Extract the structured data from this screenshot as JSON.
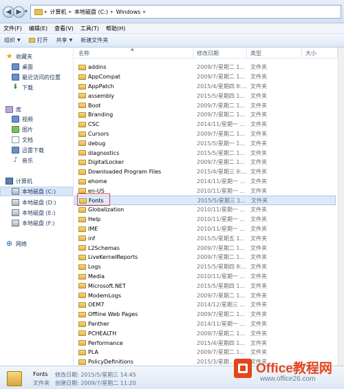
{
  "address": {
    "segments": [
      "计算机",
      "本地磁盘 (C:)",
      "Windows"
    ]
  },
  "menu": [
    "文件(F)",
    "编辑(E)",
    "查看(V)",
    "工具(T)",
    "帮助(H)"
  ],
  "toolbar": {
    "organize": "组织",
    "open": "打开",
    "share": "共享",
    "new_folder": "新建文件夹"
  },
  "sidebar": {
    "favorites": "收藏夹",
    "desktop": "桌面",
    "recent": "最近访问的位置",
    "downloads": "下载",
    "library": "库",
    "videos": "视频",
    "pictures": "图片",
    "documents": "文档",
    "thunder": "迅雷下载",
    "music": "音乐",
    "computer": "计算机",
    "drive_c": "本地磁盘 (C:)",
    "drive_d": "本地磁盘 (D:)",
    "drive_e": "本地磁盘 (E:)",
    "drive_f": "本地磁盘 (F:)",
    "network": "网络"
  },
  "columns": {
    "name": "名称",
    "date": "修改日期",
    "type": "类型",
    "size": "大小"
  },
  "files": [
    {
      "name": "addins",
      "date": "2009/7/星期二 1...",
      "type": "文件夹"
    },
    {
      "name": "AppCompat",
      "date": "2009/7/星期二 1...",
      "type": "文件夹"
    },
    {
      "name": "AppPatch",
      "date": "2015/4/星期四 8:...",
      "type": "文件夹"
    },
    {
      "name": "assembly",
      "date": "2015/5/星期四 1...",
      "type": "文件夹"
    },
    {
      "name": "Boot",
      "date": "2009/7/星期二 1...",
      "type": "文件夹"
    },
    {
      "name": "Branding",
      "date": "2009/7/星期二 1...",
      "type": "文件夹"
    },
    {
      "name": "CSC",
      "date": "2014/11/星期一 ...",
      "type": "文件夹"
    },
    {
      "name": "Cursors",
      "date": "2009/7/星期二 1...",
      "type": "文件夹"
    },
    {
      "name": "debug",
      "date": "2015/5/星期一 1...",
      "type": "文件夹"
    },
    {
      "name": "diagnostics",
      "date": "2015/5/星期二 1...",
      "type": "文件夹"
    },
    {
      "name": "DigitalLocker",
      "date": "2009/7/星期二 1...",
      "type": "文件夹"
    },
    {
      "name": "Downloaded Program Files",
      "date": "2015/4/星期三 9:...",
      "type": "文件夹"
    },
    {
      "name": "ehome",
      "date": "2014/11/星期一 ...",
      "type": "文件夹"
    },
    {
      "name": "en-US",
      "date": "2010/11/星期一 ...",
      "type": "文件夹"
    },
    {
      "name": "Fonts",
      "date": "2015/5/星期三 1...",
      "type": "文件夹"
    },
    {
      "name": "Globalization",
      "date": "2010/11/星期一 ...",
      "type": "文件夹"
    },
    {
      "name": "Help",
      "date": "2010/11/星期一 ...",
      "type": "文件夹"
    },
    {
      "name": "IME",
      "date": "2010/11/星期一 ...",
      "type": "文件夹"
    },
    {
      "name": "inf",
      "date": "2015/5/星期五 1...",
      "type": "文件夹"
    },
    {
      "name": "L2Schemas",
      "date": "2009/7/星期二 1...",
      "type": "文件夹"
    },
    {
      "name": "LiveKernelReports",
      "date": "2009/7/星期二 1...",
      "type": "文件夹"
    },
    {
      "name": "Logs",
      "date": "2015/5/星期四 8:...",
      "type": "文件夹"
    },
    {
      "name": "Media",
      "date": "2010/11/星期一 ...",
      "type": "文件夹"
    },
    {
      "name": "Microsoft.NET",
      "date": "2015/5/星期四 1...",
      "type": "文件夹"
    },
    {
      "name": "ModemLogs",
      "date": "2009/7/星期二 1...",
      "type": "文件夹"
    },
    {
      "name": "OEM7",
      "date": "2014/12/星期三 ...",
      "type": "文件夹"
    },
    {
      "name": "Offline Web Pages",
      "date": "2009/7/星期二 1...",
      "type": "文件夹"
    },
    {
      "name": "Panther",
      "date": "2014/11/星期一 ...",
      "type": "文件夹"
    },
    {
      "name": "PCHEALTH",
      "date": "2009/7/星期二 1...",
      "type": "文件夹"
    },
    {
      "name": "Performance",
      "date": "2015/4/星期四 1...",
      "type": "文件夹"
    },
    {
      "name": "PLA",
      "date": "2009/7/星期二 1...",
      "type": "文件夹"
    },
    {
      "name": "PolicyDefinitions",
      "date": "2015/3/星期...",
      "type": "文件夹"
    }
  ],
  "selected_index": 14,
  "details": {
    "name": "Fonts",
    "type": "文件夹",
    "modified": "修改日期: 2015/5/星期三 14:45",
    "created": "创建日期: 2009/7/星期二 11:20"
  },
  "watermark": {
    "title": "Office教程网",
    "url": "www.office26.com"
  },
  "colors": {
    "selection": "#dbe9fa",
    "highlight_box": "#e23c3c",
    "watermark": "#e2461d"
  }
}
